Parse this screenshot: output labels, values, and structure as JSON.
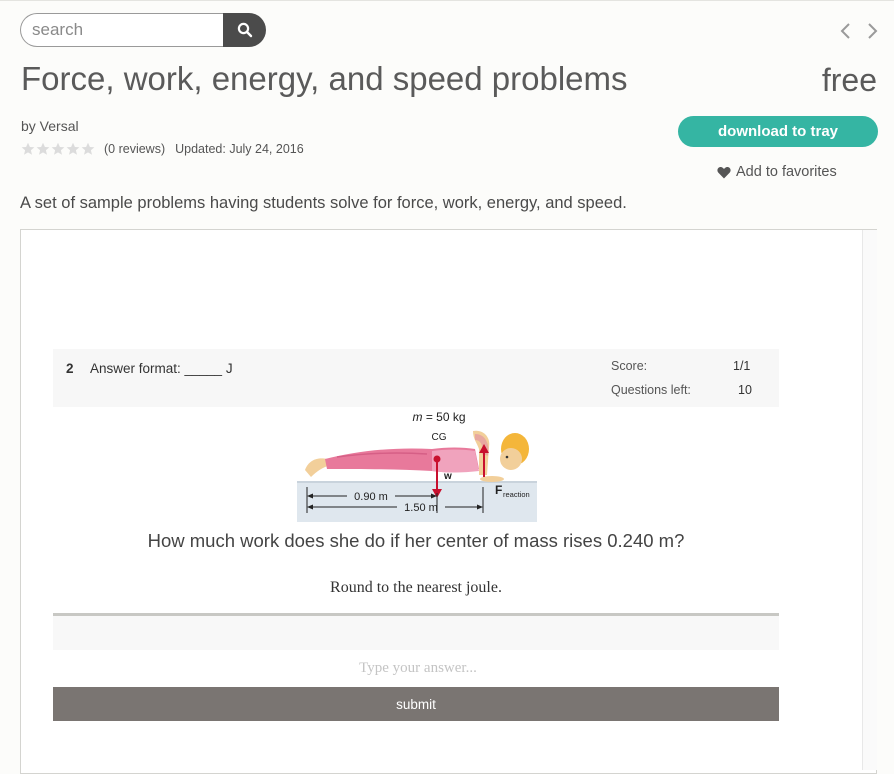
{
  "header": {
    "search": {
      "placeholder": "search",
      "button_icon": "search-icon"
    },
    "nav": {
      "prev_icon": "chevron-left-icon",
      "next_icon": "chevron-right-icon"
    }
  },
  "resource": {
    "title": "Force, work, energy, and speed problems",
    "price": "free",
    "author": "by Versal",
    "rating": {
      "stars": 0,
      "max_stars": 5,
      "reviews": "(0 reviews)"
    },
    "updated": "Updated: July 24, 2016",
    "download_label": "download to tray",
    "favorite_label": "Add to favorites",
    "description": "A set of sample problems having students solve for force, work, energy, and speed."
  },
  "colors": {
    "accent": "#35b5a3",
    "search_button": "#4b4b4b",
    "submit_button": "#7a7572"
  },
  "quiz": {
    "number": "2",
    "answer_format": "Answer format: _____ J",
    "score_label": "Score:",
    "score_value": "1/1",
    "questions_left_label": "Questions left:",
    "questions_left_value": "10",
    "figure": {
      "mass": "m = 50 kg",
      "cg": "CG",
      "w": "w",
      "f_main": "F",
      "f_sub": "reaction",
      "dist1": "0.90 m",
      "dist2": "1.50 m"
    },
    "question": "How much work does she do if her center of mass rises 0.240 m?",
    "instruction": "Round to the nearest joule.",
    "answer_placeholder": "Type your answer...",
    "submit_label": "submit"
  }
}
